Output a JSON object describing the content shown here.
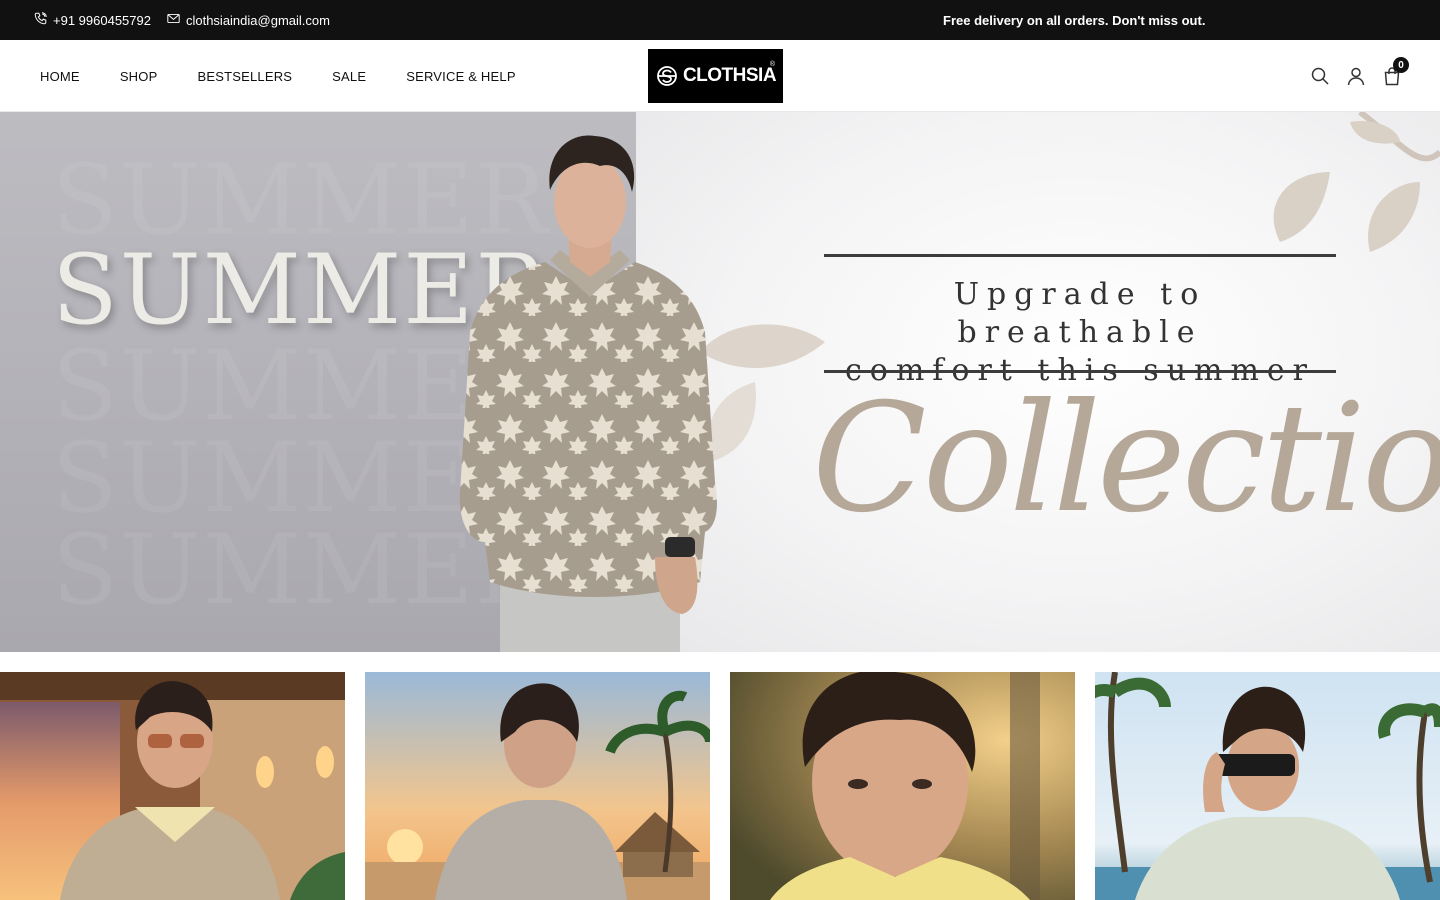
{
  "topbar": {
    "phone": "+91 9960455792",
    "email": "clothsiaindia@gmail.com",
    "promo": "Free delivery on all orders. Don't miss out."
  },
  "nav": {
    "items": [
      "HOME",
      "SHOP",
      "BESTSELLERS",
      "SALE",
      "SERVICE & HELP"
    ]
  },
  "logo": {
    "text": "CLOTHSIA",
    "reg": "®"
  },
  "header_icons": {
    "search": "search-icon",
    "account": "user-icon",
    "cart": "shopping-bag-icon",
    "cart_count": "0"
  },
  "hero": {
    "summer": "SUMMER",
    "tagline_line1": "Upgrade to breathable",
    "tagline_line2": "comfort this summer",
    "collection": "Collection"
  },
  "tiles": [
    {
      "name": "tile-sunset-leaf-shirt"
    },
    {
      "name": "tile-beach-linen-shirt"
    },
    {
      "name": "tile-yellow-shirt-portrait"
    },
    {
      "name": "tile-sunglasses-mint-shirt"
    }
  ],
  "colors": {
    "topbar_bg": "#111111",
    "hero_collection": "#b6a899",
    "accent_black": "#000000"
  }
}
